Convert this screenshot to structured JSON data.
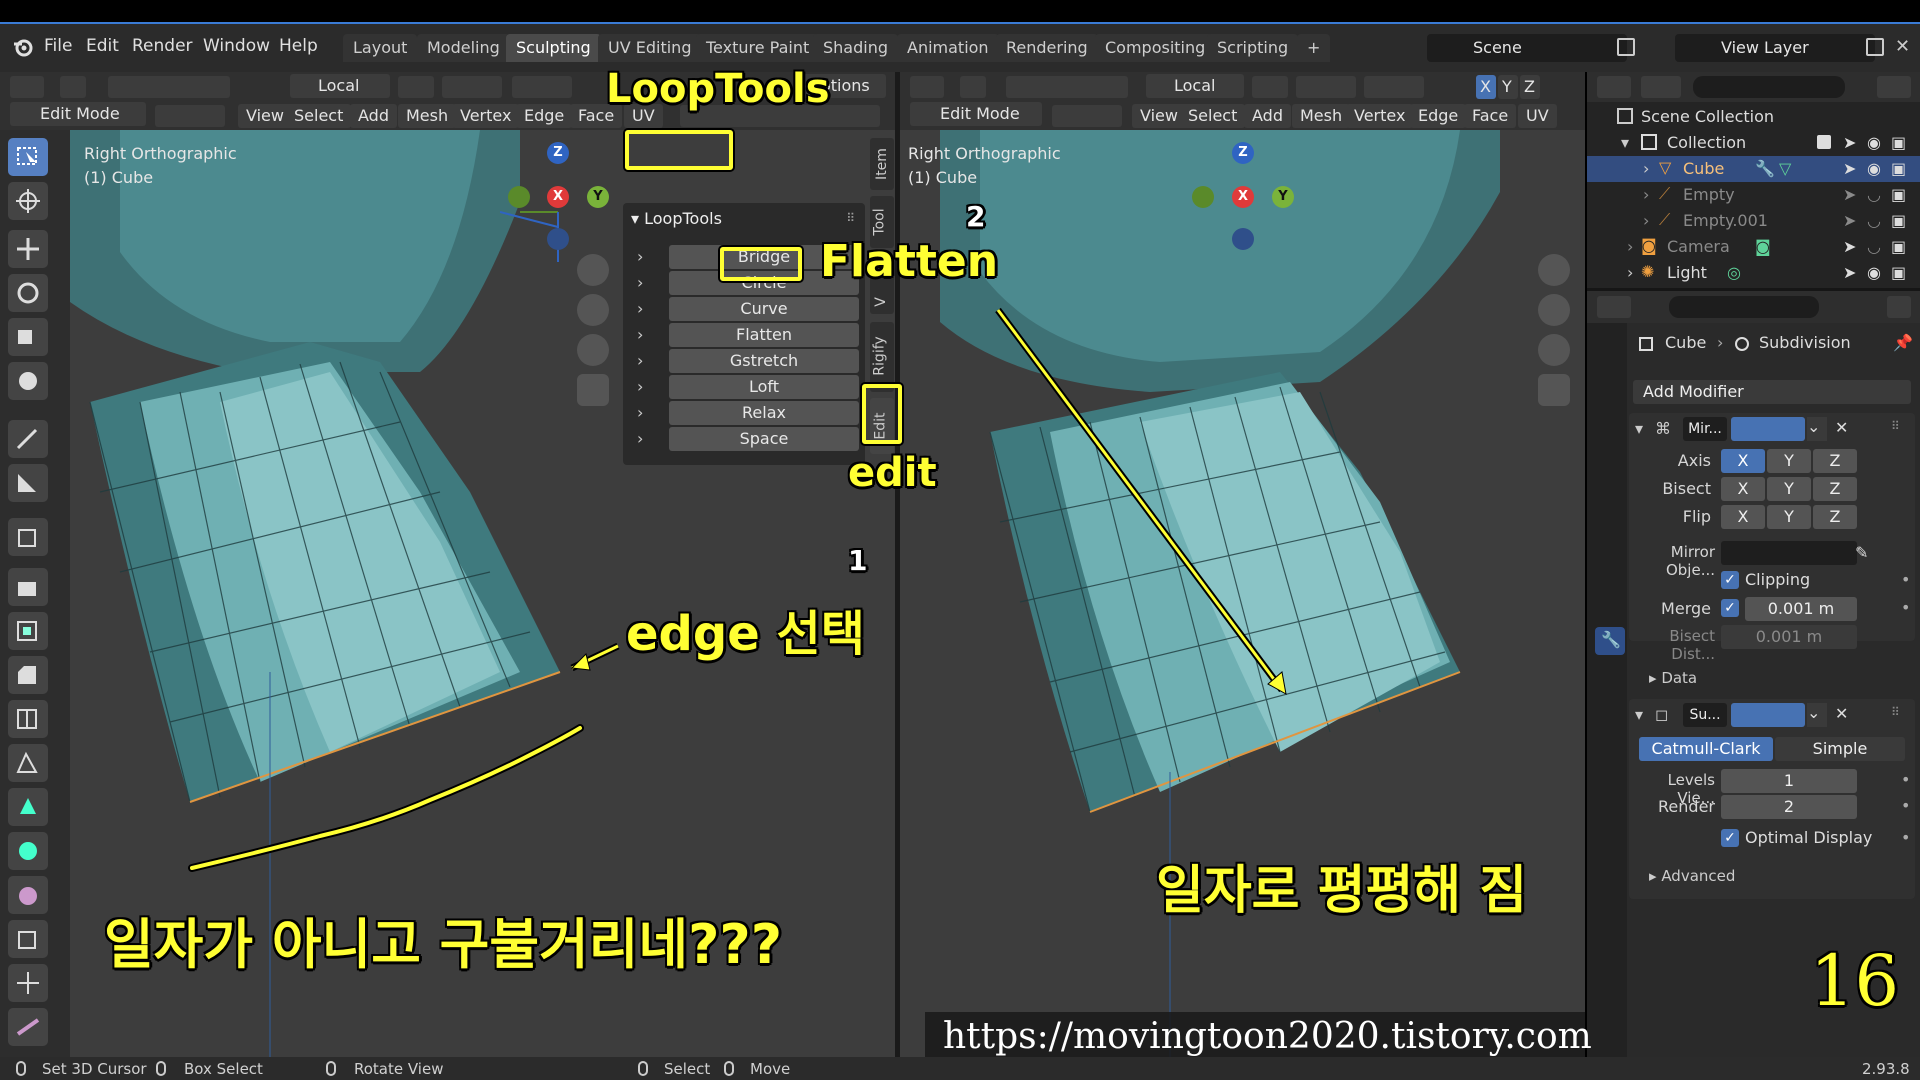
{
  "menubar": {
    "items": [
      "File",
      "Edit",
      "Render",
      "Window",
      "Help"
    ],
    "workspace_tabs": [
      "Layout",
      "Modeling",
      "Sculpting",
      "UV Editing",
      "Texture Paint",
      "Shading",
      "Animation",
      "Rendering",
      "Compositing",
      "Scripting"
    ],
    "active_tab": "Sculpting",
    "add_tab": "+",
    "scene": "Scene",
    "view_layer": "View Layer"
  },
  "left_viewport": {
    "header": {
      "orientation": "Local",
      "options": "Options",
      "mode": "Edit Mode",
      "menus": [
        "View",
        "Select",
        "Add",
        "Mesh",
        "Vertex",
        "Edge",
        "Face",
        "UV"
      ]
    },
    "info_line1": "Right Orthographic",
    "info_line2": "(1) Cube",
    "looptools": {
      "title": "LoopTools",
      "items": [
        "Bridge",
        "Circle",
        "Curve",
        "Flatten",
        "Gstretch",
        "Loft",
        "Relax",
        "Space"
      ]
    },
    "side_tabs": [
      "Item",
      "Tool",
      "V",
      "Rigify",
      "Edit"
    ]
  },
  "right_viewport": {
    "header": {
      "orientation": "Local",
      "mode": "Edit Mode",
      "menus": [
        "View",
        "Select",
        "Add",
        "Mesh",
        "Vertex",
        "Edge",
        "Face",
        "UV"
      ],
      "axes": [
        "X",
        "Y",
        "Z"
      ]
    },
    "info_line1": "Right Orthographic",
    "info_line2": "(1) Cube"
  },
  "gizmo": {
    "z": "Z",
    "x": "X",
    "y": "Y"
  },
  "annotations": {
    "looptools_label": "LoopTools",
    "flatten_label": "Flatten",
    "step2": "2",
    "edit_label": "edit",
    "step1": "1",
    "edge_select": "edge 선택",
    "left_comment": "일자가 아니고 구불거리네???",
    "right_comment": "일자로 평평해 짐",
    "page_number": "16",
    "url": "https://movingtoon2020.tistory.com"
  },
  "outliner": {
    "root": "Scene Collection",
    "collection": "Collection",
    "objects": [
      "Cube",
      "Empty",
      "Empty.001",
      "Camera",
      "Light"
    ]
  },
  "properties": {
    "breadcrumb_object": "Cube",
    "breadcrumb_modifier": "Subdivision",
    "add_modifier": "Add Modifier",
    "mirror": {
      "name": "Mir...",
      "axis_label": "Axis",
      "bisect_label": "Bisect",
      "flip_label": "Flip",
      "axes": [
        "X",
        "Y",
        "Z"
      ],
      "mirror_object_label": "Mirror Obje...",
      "clipping": "Clipping",
      "merge_label": "Merge",
      "merge_value": "0.001 m",
      "bisect_dist_label": "Bisect Dist...",
      "bisect_dist_value": "0.001 m",
      "data": "Data"
    },
    "subdivision": {
      "name": "Su...",
      "catmull": "Catmull-Clark",
      "simple": "Simple",
      "levels_label": "Levels Vie...",
      "levels_value": "1",
      "render_label": "Render",
      "render_value": "2",
      "optimal": "Optimal Display",
      "advanced": "Advanced"
    }
  },
  "statusbar": {
    "items": [
      "Set 3D Cursor",
      "Box Select",
      "Rotate View",
      "Select",
      "Move"
    ],
    "version": "2.93.8"
  },
  "colors": {
    "accent": "#4772b3",
    "annotation": "#ffff33",
    "mesh": "#5fa3a8"
  }
}
